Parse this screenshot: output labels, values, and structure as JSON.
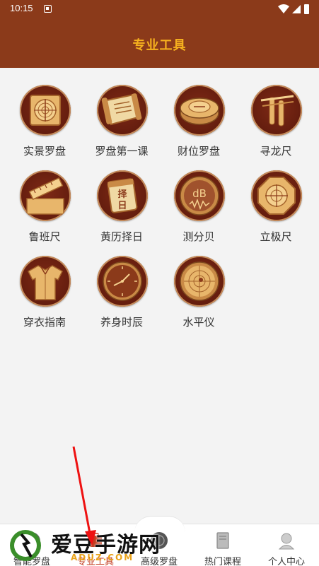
{
  "status_bar": {
    "time": "10:15"
  },
  "header": {
    "title": "专业工具"
  },
  "tools": [
    {
      "label": "实景罗盘",
      "icon": "compass-square-icon"
    },
    {
      "label": "罗盘第一课",
      "icon": "scroll-map-icon"
    },
    {
      "label": "财位罗盘",
      "icon": "bowl-compass-icon"
    },
    {
      "label": "寻龙尺",
      "icon": "dowsing-rod-icon"
    },
    {
      "label": "鲁班尺",
      "icon": "ruler-box-icon"
    },
    {
      "label": "黄历择日",
      "icon": "calendar-icon"
    },
    {
      "label": "测分贝",
      "icon": "decibel-meter-icon"
    },
    {
      "label": "立极尺",
      "icon": "octagon-compass-icon"
    },
    {
      "label": "穿衣指南",
      "icon": "robe-icon"
    },
    {
      "label": "养身时辰",
      "icon": "clock-icon"
    },
    {
      "label": "水平仪",
      "icon": "level-icon"
    }
  ],
  "icons_text": {
    "calendar_top": "择",
    "calendar_bottom": "日",
    "decibel": "dB"
  },
  "bottom_nav": [
    {
      "label": "智能罗盘",
      "icon": "compass-icon",
      "active": false
    },
    {
      "label": "专业工具",
      "icon": "tools-icon",
      "active": true
    },
    {
      "label": "高级罗盘",
      "icon": "advanced-compass-icon",
      "active": false
    },
    {
      "label": "热门课程",
      "icon": "book-icon",
      "active": false
    },
    {
      "label": "个人中心",
      "icon": "person-icon",
      "active": false
    }
  ],
  "watermark": {
    "text": "爱豆手游网",
    "url": "ADUZ.COM"
  },
  "colors": {
    "header": "#8b3a1a",
    "title": "#f6b11f",
    "active_tab": "#c23b1e"
  }
}
